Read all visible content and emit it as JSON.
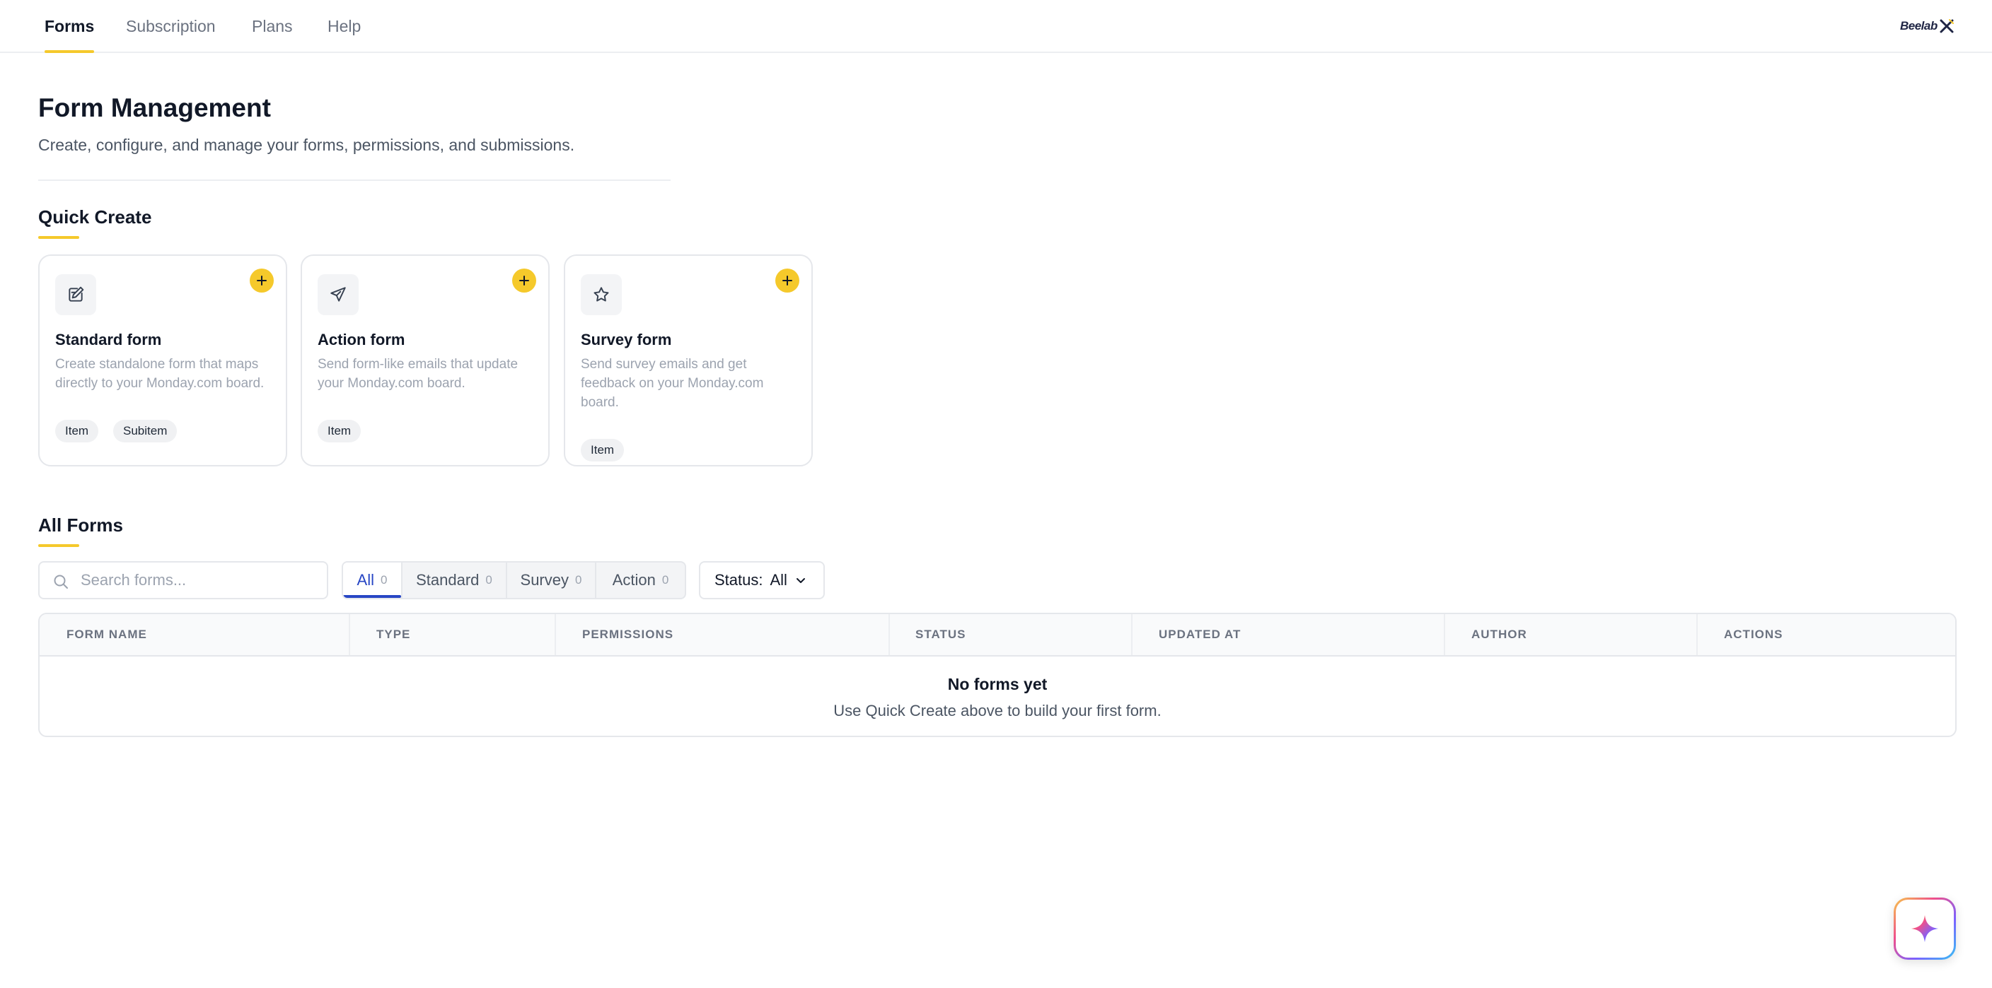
{
  "nav": {
    "tabs": [
      {
        "label": "Forms",
        "active": true
      },
      {
        "label": "Subscription",
        "active": false
      },
      {
        "label": "Plans",
        "active": false
      },
      {
        "label": "Help",
        "active": false
      }
    ],
    "brand": "Beelab"
  },
  "header": {
    "title": "Form Management",
    "subtitle": "Create, configure, and manage your forms, permissions, and submissions."
  },
  "quick_create": {
    "title": "Quick Create",
    "cards": [
      {
        "icon": "edit-form-icon",
        "title": "Standard form",
        "description": "Create standalone form that maps directly to your Monday.com board.",
        "chips": [
          "Item",
          "Subitem"
        ]
      },
      {
        "icon": "paper-plane-icon",
        "title": "Action form",
        "description": "Send form-like emails that update your Monday.com board.",
        "chips": [
          "Item"
        ]
      },
      {
        "icon": "star-icon",
        "title": "Survey form",
        "description": "Send survey emails and get feedback on your Monday.com board.",
        "chips": [
          "Item"
        ]
      }
    ]
  },
  "all_forms": {
    "title": "All Forms",
    "search_placeholder": "Search forms...",
    "segments": [
      {
        "label": "All",
        "count": "0",
        "active": true
      },
      {
        "label": "Standard",
        "count": "0",
        "active": false
      },
      {
        "label": "Survey",
        "count": "0",
        "active": false
      },
      {
        "label": "Action",
        "count": "0",
        "active": false
      }
    ],
    "status_filter": {
      "label": "Status:",
      "value": "All"
    },
    "table": {
      "columns": [
        "FORM NAME",
        "TYPE",
        "PERMISSIONS",
        "STATUS",
        "UPDATED AT",
        "AUTHOR",
        "ACTIONS"
      ],
      "rows": [],
      "empty_title": "No forms yet",
      "empty_subtitle": "Use Quick Create above to build your first form."
    }
  },
  "colors": {
    "accent_yellow": "#f5c92b",
    "active_blue": "#2746c4",
    "text_primary": "#111827",
    "text_muted": "#6b7280"
  }
}
